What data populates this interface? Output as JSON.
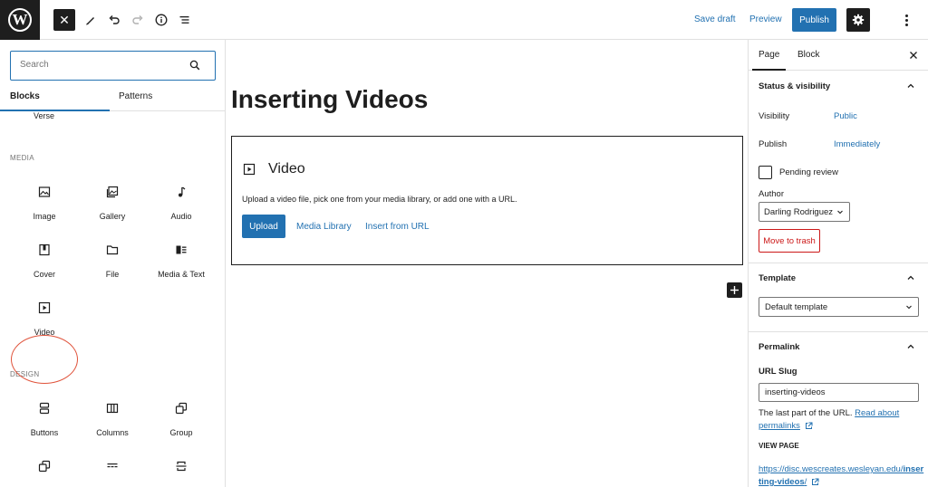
{
  "topbar": {
    "logo_letter": "W",
    "close_symbol": "✕",
    "save_draft": "Save draft",
    "preview": "Preview",
    "publish": "Publish"
  },
  "inserter": {
    "search_placeholder": "Search",
    "tabs": [
      "Blocks",
      "Patterns"
    ],
    "partial_item": "Verse",
    "categories": {
      "media": "MEDIA",
      "design": "DESIGN"
    },
    "media_blocks": [
      "Image",
      "Gallery",
      "Audio",
      "Cover",
      "File",
      "Media & Text",
      "Video"
    ],
    "design_blocks": [
      "Buttons",
      "Columns",
      "Group"
    ]
  },
  "canvas": {
    "title": "Inserting Videos",
    "video_block": {
      "title": "Video",
      "description": "Upload a video file, pick one from your media library, or add one with a URL.",
      "upload": "Upload",
      "media_library": "Media Library",
      "insert_url": "Insert from URL"
    }
  },
  "sidebar": {
    "tabs": [
      "Page",
      "Block"
    ],
    "status": {
      "heading": "Status & visibility",
      "visibility_label": "Visibility",
      "visibility_value": "Public",
      "publish_label": "Publish",
      "publish_value": "Immediately",
      "pending_review": "Pending review",
      "author_label": "Author",
      "author_value": "Darling Rodriguez",
      "trash": "Move to trash"
    },
    "template": {
      "heading": "Template",
      "value": "Default template"
    },
    "permalink": {
      "heading": "Permalink",
      "slug_label": "URL Slug",
      "slug_value": "inserting-videos",
      "help_prefix": "The last part of the URL.",
      "help_link": "Read about permalinks",
      "view_page_label": "VIEW PAGE",
      "view_url_prefix": "https://disc.wescreates.wesleyan.edu/",
      "view_url_bold": "inserting-videos",
      "view_url_suffix": "/"
    }
  },
  "colors": {
    "accent": "#2271b1",
    "dark": "#1e1e1e",
    "danger": "#cc1818",
    "highlight_circle": "#e0533b"
  }
}
